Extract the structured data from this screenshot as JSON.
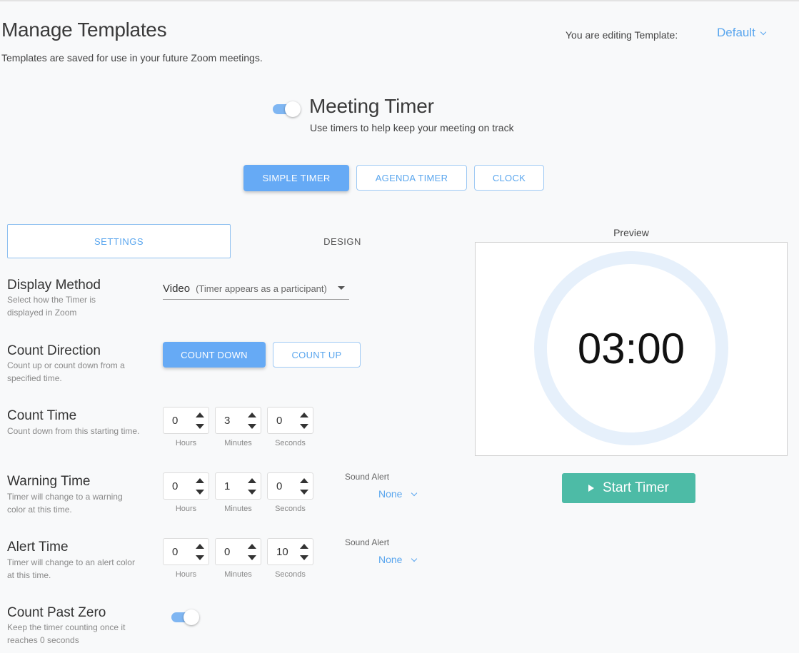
{
  "header": {
    "title": "Manage Templates",
    "subtitle": "Templates are saved for use in your future Zoom meetings.",
    "editing_label": "You are editing Template:",
    "template_value": "Default"
  },
  "meeting_timer": {
    "enabled": true,
    "title": "Meeting Timer",
    "subtitle": "Use timers to help keep your meeting on track"
  },
  "mode_tabs": [
    {
      "label": "SIMPLE TIMER",
      "active": true
    },
    {
      "label": "AGENDA TIMER",
      "active": false
    },
    {
      "label": "CLOCK",
      "active": false
    }
  ],
  "panel_tabs": [
    {
      "label": "SETTINGS",
      "active": true
    },
    {
      "label": "DESIGN",
      "active": false
    }
  ],
  "display_method": {
    "title": "Display Method",
    "desc": "Select how the Timer is displayed in Zoom",
    "value": "Video",
    "hint": "(Timer appears as a participant)"
  },
  "count_direction": {
    "title": "Count Direction",
    "desc": "Count up or count down from a specified time.",
    "options": [
      "COUNT DOWN",
      "COUNT UP"
    ],
    "selected": "COUNT DOWN"
  },
  "units": {
    "hours": "Hours",
    "minutes": "Minutes",
    "seconds": "Seconds"
  },
  "count_time": {
    "title": "Count Time",
    "desc": "Count down from this starting time.",
    "hours": "0",
    "minutes": "3",
    "seconds": "0"
  },
  "warning_time": {
    "title": "Warning Time",
    "desc": "Timer will change to a warning color at this time.",
    "hours": "0",
    "minutes": "1",
    "seconds": "0",
    "sound_label": "Sound Alert",
    "sound_value": "None"
  },
  "alert_time": {
    "title": "Alert Time",
    "desc": "Timer will change to an alert color at this time.",
    "hours": "0",
    "minutes": "0",
    "seconds": "10",
    "sound_label": "Sound Alert",
    "sound_value": "None"
  },
  "count_past_zero": {
    "title": "Count Past Zero",
    "desc": "Keep the timer counting once it reaches 0 seconds",
    "enabled": true
  },
  "preview": {
    "label": "Preview",
    "time": "03:00",
    "start_label": "Start Timer"
  },
  "colors": {
    "accent": "#66aaf5",
    "link": "#5aa6ee",
    "start": "#4dbba6",
    "ring": "#e6f0fb"
  }
}
